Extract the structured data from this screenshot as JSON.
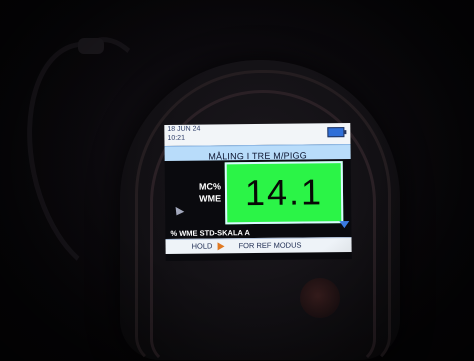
{
  "status_bar": {
    "date": "18 JUN 24",
    "time": "10:21",
    "battery_icon": "battery-icon"
  },
  "title": "MÅLING I TRE M/PIGG",
  "measurement": {
    "label_line1": "MC%",
    "label_line2": "WME",
    "value": "14.1",
    "value_box_color": "#2bf447"
  },
  "scale": "% WME STD-SKALA A",
  "bottom_bar": {
    "hold_label": "HOLD",
    "play_icon": "play-icon",
    "ref_label": "FOR REF MODUS"
  },
  "icons": {
    "scroll": "scroll-down-icon",
    "pointer": "pointer-icon"
  },
  "colors": {
    "title_bar": "#b8dcfa",
    "accent": "#3a7ae0",
    "arrow": "#e07a24"
  }
}
